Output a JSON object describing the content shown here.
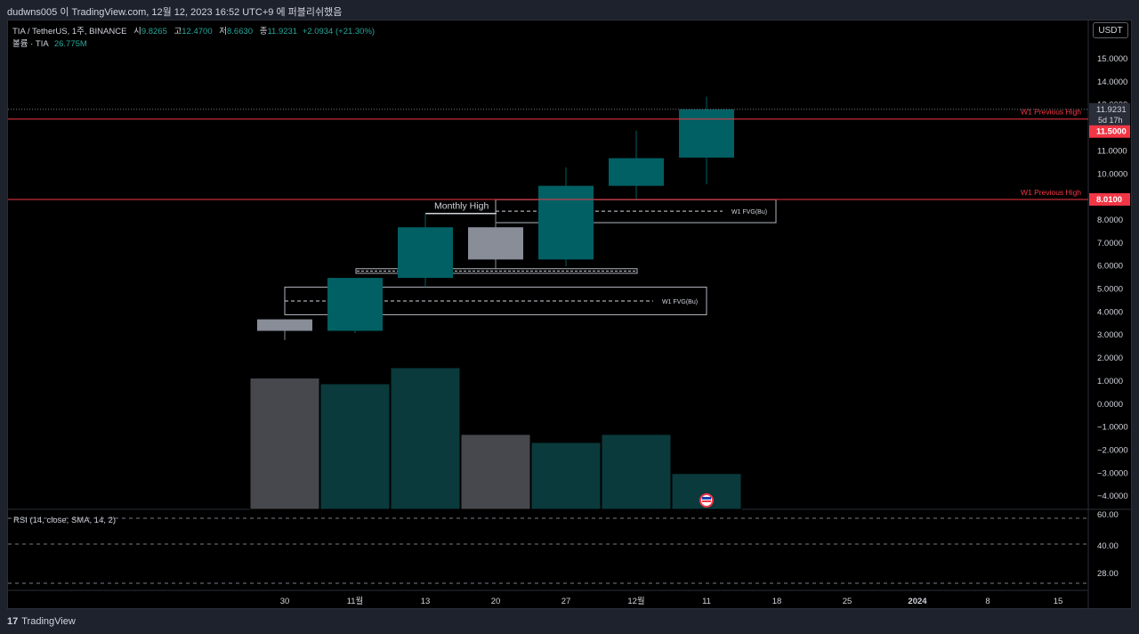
{
  "window": {
    "title": "dudwns005 이 TradingView.com, 12월 12, 2023 16:52 UTC+9 에 퍼블리쉬했음"
  },
  "legend": {
    "symbol": "TIA / TetherUS, 1주, BINANCE",
    "open_label": "시",
    "open": "9.8265",
    "high_label": "고",
    "high": "12.4700",
    "low_label": "저",
    "low": "8.6630",
    "close_label": "종",
    "close": "11.9231",
    "change": "+2.0934 (+21.30%)",
    "volume_label": "볼륨 · TIA",
    "volume": "26.775M"
  },
  "currency_button": "USDT",
  "price_axis_labels": [
    "15.0000",
    "14.0000",
    "13.0000",
    "12.0000",
    "11.0000",
    "10.0000",
    "9.0000",
    "8.0000",
    "7.0000",
    "6.0000",
    "5.0000",
    "4.0000",
    "3.0000",
    "2.0000",
    "1.0000",
    "0.0000",
    "−1.0000",
    "−2.0000",
    "−3.0000",
    "−4.0000"
  ],
  "time_axis_labels": [
    "30",
    "11월",
    "13",
    "20",
    "27",
    "12월",
    "11",
    "18",
    "25",
    "2024",
    "8",
    "15"
  ],
  "price_tags": {
    "last": "11.9231",
    "countdown": "5d 17h",
    "level_high": "11.5000",
    "level_low": "8.0100"
  },
  "annotations": {
    "w1_previous_high": "W1 Previous High",
    "monthly_high": "Monthly High",
    "fvg": "W1 FVG(Bu)"
  },
  "rsi": {
    "label": "RSI (14, close, SMA, 14, 2)",
    "axis_labels": [
      "60.00",
      "40.00",
      "28.00"
    ]
  },
  "footer": {
    "brand": "TradingView"
  },
  "colors": {
    "bull": "#006064",
    "bear": "#888d98",
    "level": "#f23645",
    "background": "#000000"
  },
  "chart_data": {
    "type": "candlestick",
    "y_range": [
      -4.5,
      15.5
    ],
    "candles": [
      {
        "x": "Oct 30",
        "open": 2.8,
        "high": 2.8,
        "low": 1.9,
        "close": 2.3
      },
      {
        "x": "Nov 6",
        "open": 2.3,
        "high": 4.6,
        "low": 2.2,
        "close": 4.6
      },
      {
        "x": "Nov 13",
        "open": 4.6,
        "high": 7.4,
        "low": 4.2,
        "close": 6.8
      },
      {
        "x": "Nov 20",
        "open": 6.8,
        "high": 7.4,
        "low": 5.0,
        "close": 5.4
      },
      {
        "x": "Nov 27",
        "open": 5.4,
        "high": 9.4,
        "low": 5.1,
        "close": 8.6
      },
      {
        "x": "Dec 4",
        "open": 8.6,
        "high": 11.0,
        "low": 8.0,
        "close": 9.8
      },
      {
        "x": "Dec 11",
        "open": 9.8265,
        "high": 12.47,
        "low": 8.663,
        "close": 11.9231
      }
    ],
    "volume_bars": [
      {
        "x": "Oct 30",
        "top": 0.25,
        "bull": false
      },
      {
        "x": "Nov 6",
        "top": 0.0,
        "bull": true
      },
      {
        "x": "Nov 13",
        "top": 0.7,
        "bull": true
      },
      {
        "x": "Nov 20",
        "top": -2.2,
        "bull": false
      },
      {
        "x": "Nov 27",
        "top": -2.55,
        "bull": true
      },
      {
        "x": "Dec 4",
        "top": -2.2,
        "bull": true
      },
      {
        "x": "Dec 11",
        "top": -3.9,
        "bull": true
      }
    ],
    "levels": [
      11.5,
      8.01
    ],
    "monthly_high": 7.4,
    "fvg_zones": [
      {
        "from": "Oct 30",
        "top": 4.2,
        "mid": 3.6,
        "bottom": 3.0
      },
      {
        "from": "Nov 20",
        "top": 8.0,
        "mid": 7.5,
        "bottom": 7.0
      }
    ],
    "consolidation_range": [
      4.8,
      5.0
    ]
  }
}
